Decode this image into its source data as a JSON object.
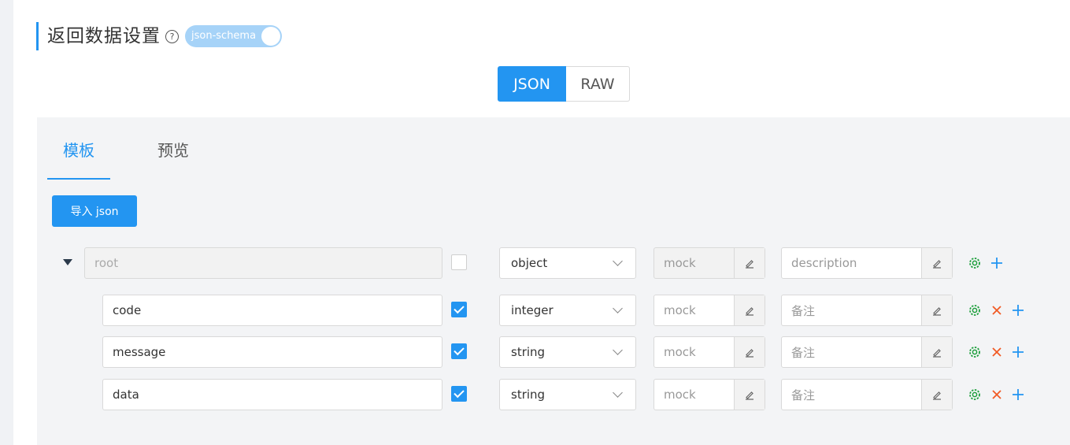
{
  "header": {
    "title": "返回数据设置",
    "help_icon": "?",
    "schema_switch": {
      "label": "json-schema",
      "on": true
    }
  },
  "format_toggle": {
    "json_label": "JSON",
    "raw_label": "RAW",
    "selected": "JSON"
  },
  "tabs": [
    {
      "label": "模板",
      "active": true
    },
    {
      "label": "预览",
      "active": false
    }
  ],
  "import_button": "导入 json",
  "root_row": {
    "name": "root",
    "required": false,
    "type": "object",
    "mock_placeholder": "mock",
    "description_placeholder": "description"
  },
  "fields": [
    {
      "name": "code",
      "required": true,
      "type": "integer",
      "mock_placeholder": "mock",
      "remark_placeholder": "备注"
    },
    {
      "name": "message",
      "required": true,
      "type": "string",
      "mock_placeholder": "mock",
      "remark_placeholder": "备注"
    },
    {
      "name": "data",
      "required": true,
      "type": "string",
      "mock_placeholder": "mock",
      "remark_placeholder": "备注"
    }
  ],
  "colors": {
    "accent": "#2395f1",
    "settings_icon": "#1e9f3d",
    "delete_icon": "#f15a24",
    "add_icon": "#2395f1"
  },
  "icons": {
    "help": "question-circle-icon",
    "collapse": "caret-down-icon",
    "edit": "pencil-edit-icon",
    "settings": "gear-icon",
    "delete": "close-icon",
    "add": "plus-icon"
  }
}
